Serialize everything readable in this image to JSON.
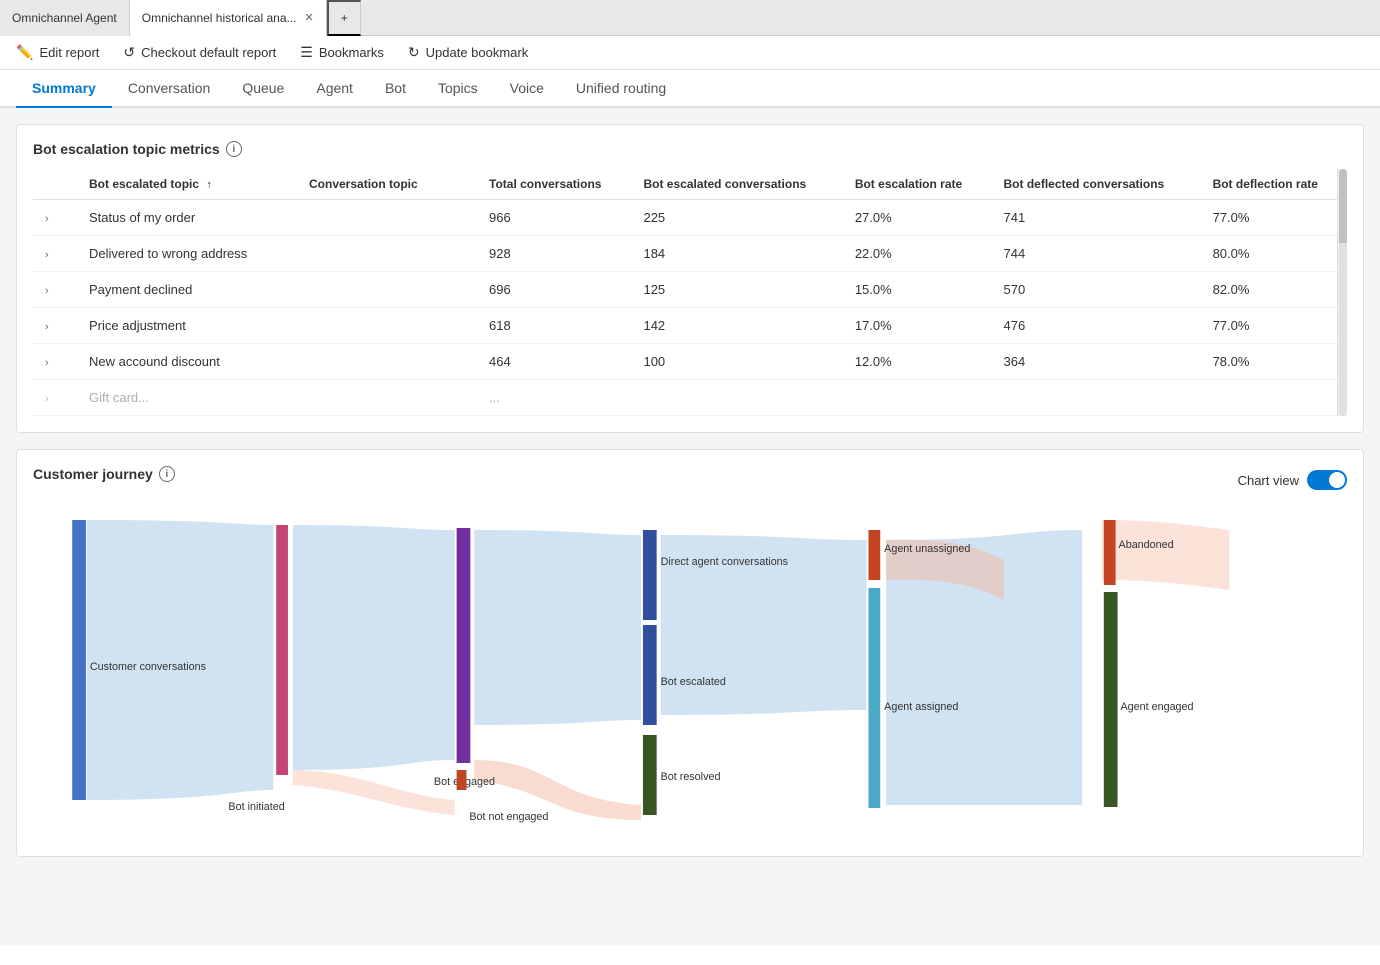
{
  "browser": {
    "tabs": [
      {
        "label": "Omnichannel Agent",
        "active": false
      },
      {
        "label": "Omnichannel historical ana...",
        "active": true,
        "closeable": true
      }
    ],
    "add_tab_label": "+"
  },
  "toolbar": {
    "items": [
      {
        "icon": "✏️",
        "label": "Edit report"
      },
      {
        "icon": "↺",
        "label": "Checkout default report"
      },
      {
        "icon": "☰",
        "label": "Bookmarks"
      },
      {
        "icon": "↻",
        "label": "Update bookmark"
      }
    ]
  },
  "nav": {
    "tabs": [
      {
        "label": "Summary",
        "active": true
      },
      {
        "label": "Conversation",
        "active": false
      },
      {
        "label": "Queue",
        "active": false
      },
      {
        "label": "Agent",
        "active": false
      },
      {
        "label": "Bot",
        "active": false
      },
      {
        "label": "Topics",
        "active": false
      },
      {
        "label": "Voice",
        "active": false
      },
      {
        "label": "Unified routing",
        "active": false
      }
    ]
  },
  "bot_escalation": {
    "title": "Bot escalation topic metrics",
    "columns": [
      "Bot escalated topic",
      "Conversation topic",
      "Total conversations",
      "Bot escalated conversations",
      "Bot escalation rate",
      "Bot deflected conversations",
      "Bot deflection rate"
    ],
    "sort_indicator": "↑",
    "rows": [
      {
        "topic": "Status of my order",
        "conv_topic": "",
        "total": "966",
        "escalated": "225",
        "escalation_rate": "27.0%",
        "deflected": "741",
        "deflection_rate": "77.0%"
      },
      {
        "topic": "Delivered to wrong address",
        "conv_topic": "",
        "total": "928",
        "escalated": "184",
        "escalation_rate": "22.0%",
        "deflected": "744",
        "deflection_rate": "80.0%"
      },
      {
        "topic": "Payment declined",
        "conv_topic": "",
        "total": "696",
        "escalated": "125",
        "escalation_rate": "15.0%",
        "deflected": "570",
        "deflection_rate": "82.0%"
      },
      {
        "topic": "Price adjustment",
        "conv_topic": "",
        "total": "618",
        "escalated": "142",
        "escalation_rate": "17.0%",
        "deflected": "476",
        "deflection_rate": "77.0%"
      },
      {
        "topic": "New accound discount",
        "conv_topic": "",
        "total": "464",
        "escalated": "100",
        "escalation_rate": "12.0%",
        "deflected": "364",
        "deflection_rate": "78.0%"
      }
    ]
  },
  "customer_journey": {
    "title": "Customer journey",
    "chart_view_label": "Chart view",
    "toggle_on": true,
    "nodes": [
      {
        "id": "customer_conv",
        "label": "Customer conversations",
        "color": "#4472C4"
      },
      {
        "id": "bot_initiated",
        "label": "Bot initiated",
        "color": "#C44472"
      },
      {
        "id": "bot_engaged",
        "label": "Bot engaged",
        "color": "#7030A0"
      },
      {
        "id": "bot_not_engaged",
        "label": "Bot not engaged",
        "color": "#C44422"
      },
      {
        "id": "direct_agent",
        "label": "Direct agent conversations",
        "color": "#2F4EA0"
      },
      {
        "id": "bot_escalated",
        "label": "Bot escalated",
        "color": "#2F4EA0"
      },
      {
        "id": "bot_resolved",
        "label": "Bot resolved",
        "color": "#375623"
      },
      {
        "id": "agent_unassigned",
        "label": "Agent unassigned",
        "color": "#C44422"
      },
      {
        "id": "abandoned",
        "label": "Abandoned",
        "color": "#C44422"
      },
      {
        "id": "agent_assigned",
        "label": "Agent assigned",
        "color": "#4BA9C8"
      },
      {
        "id": "agent_engaged",
        "label": "Agent engaged",
        "color": "#375623"
      }
    ]
  }
}
